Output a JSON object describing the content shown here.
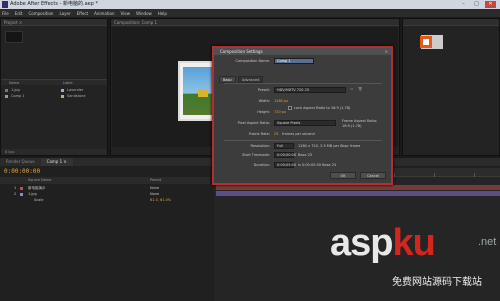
{
  "titlebar": {
    "title": "Adobe After Effects - 新电脑的.aep *"
  },
  "menu": [
    "File",
    "Edit",
    "Composition",
    "Layer",
    "Effect",
    "Animation",
    "View",
    "Window",
    "Help"
  ],
  "project": {
    "tab": "Project ×",
    "header_name": "Name",
    "header_label": "Label",
    "rows": [
      {
        "name": "1.jpg",
        "label": "Lavender",
        "chip_color": "#b89be0"
      },
      {
        "name": "Comp 1",
        "label": "Sandstone",
        "chip_color": "#c7a77d"
      }
    ],
    "footer": "8 bpc"
  },
  "viewer": {
    "tab": "Composition: Comp 1"
  },
  "timeline": {
    "tabs": [
      "Render Queue",
      "Comp 1 ×"
    ],
    "timecode": "0:00:00:00",
    "columns": {
      "source": "Source Name",
      "parent": "Parent"
    },
    "layers": [
      {
        "num": "1",
        "name": "新电脑演示",
        "color": "#c94a4a",
        "parent": "None"
      },
      {
        "num": "2",
        "name": "1.jpg",
        "color": "#9a7fd4",
        "parent": "None"
      },
      {
        "num": "",
        "name": "Scale",
        "color": "",
        "parent": "61.0, 61.0%"
      }
    ]
  },
  "dialog": {
    "title": "Composition Settings",
    "close": "×",
    "comp_name_label": "Composition Name:",
    "comp_name_value": "Comp 1",
    "tabs": [
      "Basic",
      "Advanced"
    ],
    "preset_label": "Preset:",
    "preset_value": "HDV/HDTV 720 25",
    "width_label": "Width:",
    "width_value": "1280 px",
    "height_label": "Height:",
    "height_value": "720 px",
    "lock_label": "Lock Aspect Ratio to 16:9 (1.78)",
    "pixel_aspect_label": "Pixel Aspect Ratio:",
    "pixel_aspect_value": "Square Pixels",
    "frame_aspect_label": "Frame Aspect Ratio:",
    "frame_aspect_value": "16:9 (1.78)",
    "frame_rate_label": "Frame Rate:",
    "frame_rate_value": "25",
    "frame_rate_unit": "frames per second",
    "resolution_label": "Resolution:",
    "resolution_value": "Full",
    "resolution_info": "1280 x 720, 3.5 MB per 8bpc frame",
    "start_tc_label": "Start Timecode:",
    "start_tc_value": "0:00:00:00",
    "start_tc_base": "Base 25",
    "duration_label": "Duration:",
    "duration_value": "0:00:05:00",
    "duration_info": "is 0:00:05:00 Base 25",
    "ok": "OK",
    "cancel": "Cancel"
  },
  "watermark": {
    "main_left": "asp",
    "main_red": "ku",
    "net": ".net",
    "sub": "免费网站源码下载站"
  }
}
